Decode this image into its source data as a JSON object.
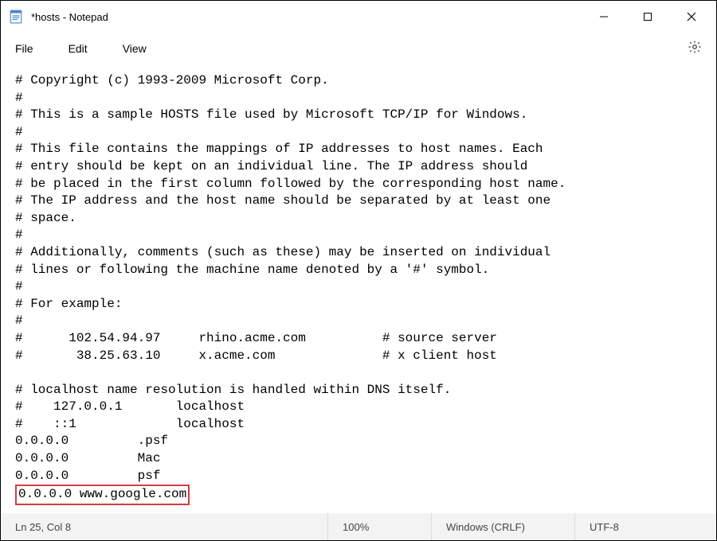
{
  "titlebar": {
    "title": "*hosts - Notepad"
  },
  "menubar": {
    "file": "File",
    "edit": "Edit",
    "view": "View"
  },
  "editor": {
    "lines": [
      "# Copyright (c) 1993-2009 Microsoft Corp.",
      "#",
      "# This is a sample HOSTS file used by Microsoft TCP/IP for Windows.",
      "#",
      "# This file contains the mappings of IP addresses to host names. Each",
      "# entry should be kept on an individual line. The IP address should",
      "# be placed in the first column followed by the corresponding host name.",
      "# The IP address and the host name should be separated by at least one",
      "# space.",
      "#",
      "# Additionally, comments (such as these) may be inserted on individual",
      "# lines or following the machine name denoted by a '#' symbol.",
      "#",
      "# For example:",
      "#",
      "#      102.54.94.97     rhino.acme.com          # source server",
      "#       38.25.63.10     x.acme.com              # x client host",
      "",
      "# localhost name resolution is handled within DNS itself.",
      "#    127.0.0.1       localhost",
      "#    ::1             localhost",
      "0.0.0.0         .psf",
      "0.0.0.0         Mac",
      "0.0.0.0         psf"
    ],
    "highlighted_line": "0.0.0.0 www.google.com"
  },
  "statusbar": {
    "position": "Ln 25, Col 8",
    "zoom": "100%",
    "eol": "Windows (CRLF)",
    "encoding": "UTF-8"
  }
}
